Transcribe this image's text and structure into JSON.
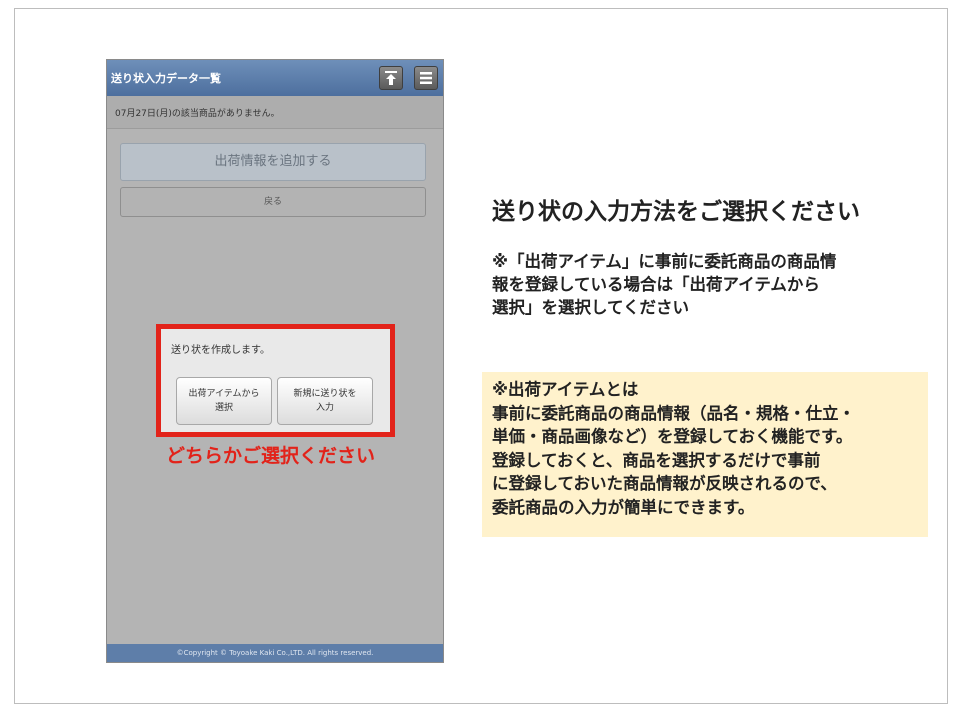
{
  "phone": {
    "title": "送り状入力データ一覧",
    "notice": "07月27日(月)の該当商品がありません。",
    "add_button": "出荷情報を追加する",
    "back_button": "戻る",
    "footer": "©Copyright © Toyoake Kaki Co.,LTD. All rights reserved.",
    "header_icons": [
      "scroll-top-icon",
      "menu-icon"
    ]
  },
  "dialog": {
    "message": "送り状を作成します。",
    "select_from_items": "出荷アイテムから\n選択",
    "input_new": "新規に送り状を\n入力"
  },
  "annotation": {
    "caption": "どちらかご選択ください",
    "color": "#e2231a"
  },
  "heading": "送り状の入力方法をご選択ください",
  "note_lines": [
    "※「出荷アイテム」に事前に委託商品の商品情",
    "報を登録している場合は「出荷アイテムから",
    "選択」を選択してください"
  ],
  "info_lines": [
    "※出荷アイテムとは",
    "事前に委託商品の商品情報（品名・規格・仕立・",
    "単価・商品画像など）を登録しておく機能です。",
    "登録しておくと、商品を選択するだけで事前",
    "に登録しておいた商品情報が反映されるので、",
    "委託商品の入力が簡単にできます。"
  ],
  "colors": {
    "header": "#4d6f9e",
    "info_background": "#fff2cc"
  }
}
